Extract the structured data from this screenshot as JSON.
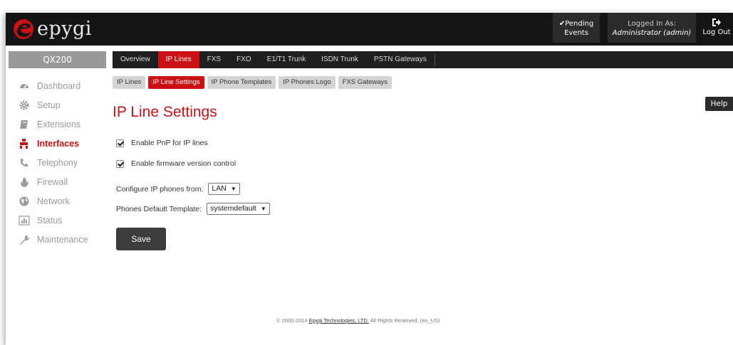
{
  "brand": {
    "name": "epygi",
    "accent": "#cc1114"
  },
  "header": {
    "pending": {
      "line1": "✔Pending",
      "line2": "Events"
    },
    "logged_in": {
      "label": "Logged In As:",
      "user": "Administrator (admin)"
    },
    "logout": {
      "label": "Log Out",
      "icon": "logout-icon"
    }
  },
  "device": "QX200",
  "tabs": [
    {
      "label": "Overview",
      "active": false
    },
    {
      "label": "IP Lines",
      "active": true
    },
    {
      "label": "FXS",
      "active": false
    },
    {
      "label": "FXO",
      "active": false
    },
    {
      "label": "E1/T1 Trunk",
      "active": false
    },
    {
      "label": "ISDN Trunk",
      "active": false
    },
    {
      "label": "PSTN Gateways",
      "active": false
    }
  ],
  "sidebar": {
    "items": [
      {
        "label": "Dashboard",
        "icon": "dashboard-icon",
        "active": false
      },
      {
        "label": "Setup",
        "icon": "gear-icon",
        "active": false
      },
      {
        "label": "Extensions",
        "icon": "notebook-icon",
        "active": false
      },
      {
        "label": "Interfaces",
        "icon": "puzzle-icon",
        "active": true
      },
      {
        "label": "Telephony",
        "icon": "phone-icon",
        "active": false
      },
      {
        "label": "Firewall",
        "icon": "flame-icon",
        "active": false
      },
      {
        "label": "Network",
        "icon": "globe-icon",
        "active": false
      },
      {
        "label": "Status",
        "icon": "bar-chart-icon",
        "active": false
      },
      {
        "label": "Maintenance",
        "icon": "wrench-icon",
        "active": false
      }
    ]
  },
  "subtabs": [
    {
      "label": "IP Lines",
      "active": false
    },
    {
      "label": "IP Line Settings",
      "active": true
    },
    {
      "label": "IP Phone Templates",
      "active": false
    },
    {
      "label": "IP Phones Logo",
      "active": false
    },
    {
      "label": "FXS Gateways",
      "active": false
    }
  ],
  "help": "Help",
  "page": {
    "title": "IP Line Settings",
    "checkboxes": [
      {
        "label": "Enable PnP for IP lines",
        "checked": true
      },
      {
        "label": "Enable firmware version control",
        "checked": true
      }
    ],
    "configure_from": {
      "label": "Configure IP phones from:",
      "value": "LAN"
    },
    "default_template": {
      "label": "Phones Default Template:",
      "value": "systemdefault"
    },
    "save": "Save"
  },
  "footer": {
    "prefix": "© 2000-2014",
    "link": "Epygi Technologies, LTD.",
    "suffix": "All Rights Reserved. (en_US)"
  }
}
